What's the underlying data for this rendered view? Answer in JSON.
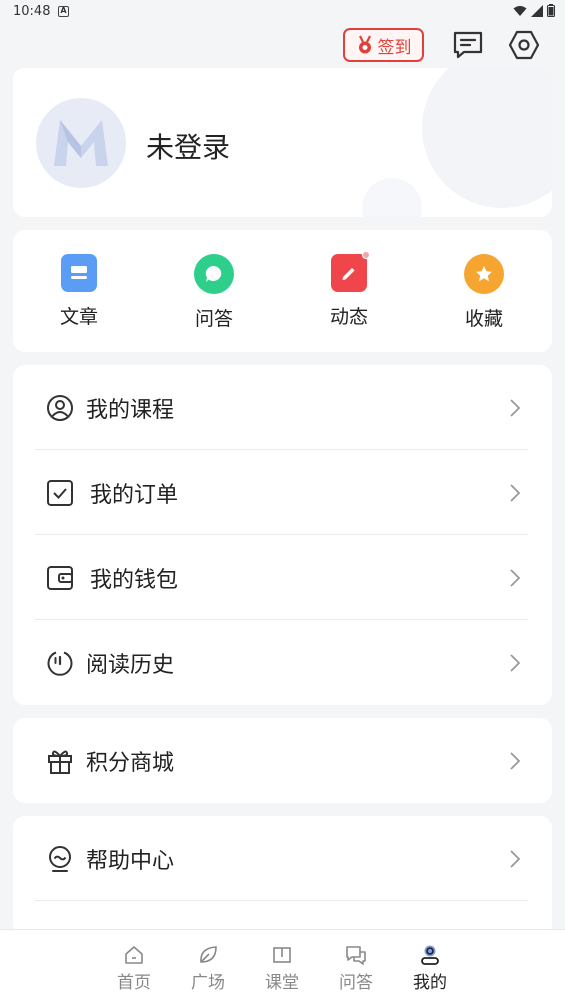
{
  "status_bar": {
    "time": "10:48",
    "notif_badge": "A"
  },
  "header": {
    "checkin_label": "签到"
  },
  "profile": {
    "name": "未登录"
  },
  "quick_actions": [
    {
      "label": "文章",
      "icon": "article-icon",
      "color": "#5b9cf5"
    },
    {
      "label": "问答",
      "icon": "chat-bubble-icon",
      "color": "#2ecf8b"
    },
    {
      "label": "动态",
      "icon": "pencil-icon",
      "color": "#f0454a"
    },
    {
      "label": "收藏",
      "icon": "star-icon",
      "color": "#f7a531"
    }
  ],
  "menu_group1": [
    {
      "label": "我的课程",
      "icon": "user-circle-icon"
    },
    {
      "label": "我的订单",
      "icon": "checkbox-icon"
    },
    {
      "label": "我的钱包",
      "icon": "wallet-icon"
    },
    {
      "label": "阅读历史",
      "icon": "history-icon"
    }
  ],
  "menu_group2": [
    {
      "label": "积分商城",
      "icon": "gift-icon"
    }
  ],
  "menu_group3": [
    {
      "label": "帮助中心",
      "icon": "help-icon"
    }
  ],
  "tabs": [
    {
      "label": "首页",
      "icon": "home-icon",
      "active": false
    },
    {
      "label": "广场",
      "icon": "leaf-icon",
      "active": false
    },
    {
      "label": "课堂",
      "icon": "book-icon",
      "active": false
    },
    {
      "label": "问答",
      "icon": "qa-icon",
      "active": false
    },
    {
      "label": "我的",
      "icon": "profile-icon",
      "active": true
    }
  ],
  "colors": {
    "accent_red": "#e0413a",
    "card_bg": "#ffffff",
    "page_bg": "#f4f5f7"
  }
}
